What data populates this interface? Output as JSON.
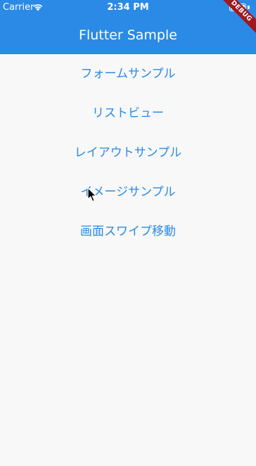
{
  "status_bar": {
    "carrier": "Carrier",
    "time": "2:34 PM",
    "icons": [
      "wifi-icon",
      "battery-icon"
    ]
  },
  "app_bar": {
    "title": "Flutter Sample",
    "debug_banner": "DEBUG",
    "color": "#2a8ae6"
  },
  "menu": {
    "items": [
      {
        "label": "フォームサンプル"
      },
      {
        "label": "リストビュー"
      },
      {
        "label": "レイアウトサンプル"
      },
      {
        "label": "イメージサンプル"
      },
      {
        "label": "画面スワイプ移動"
      }
    ],
    "link_color": "#2a8ae6"
  },
  "pointer": {
    "icon": "cursor-arrow-icon"
  }
}
